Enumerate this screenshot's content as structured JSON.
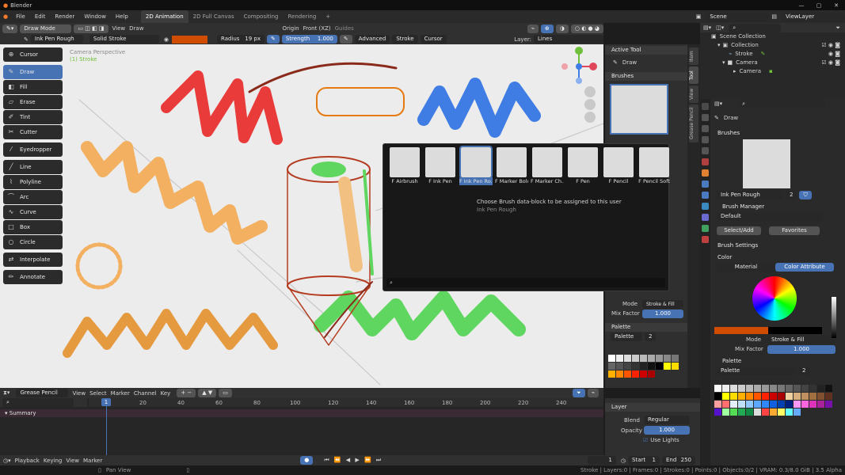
{
  "window": {
    "title": "Blender"
  },
  "menu": [
    "File",
    "Edit",
    "Render",
    "Window",
    "Help"
  ],
  "workspaces": [
    "2D Animation",
    "2D Full Canvas",
    "Compositing",
    "Rendering"
  ],
  "workspace_add": "+",
  "scene": "Scene",
  "view_layer": "ViewLayer",
  "header": {
    "mode": "Draw Mode",
    "view": "View",
    "draw": "Draw",
    "origin": "Origin",
    "front": "Front (XZ)",
    "guides": "Guides"
  },
  "tool_settings": {
    "brush": "Ink Pen Rough",
    "material": "Solid Stroke",
    "radius_label": "Radius",
    "radius": "19 px",
    "strength_label": "Strength",
    "strength": "1.000",
    "advanced": "Advanced",
    "stroke": "Stroke",
    "cursor": "Cursor",
    "layer_label": "Layer:",
    "layer": "Lines"
  },
  "tools": [
    {
      "label": "Cursor",
      "icon": "cursor-icon"
    },
    {
      "label": "Draw",
      "icon": "pencil-icon",
      "active": true
    },
    {
      "label": "Fill",
      "icon": "fill-icon"
    },
    {
      "label": "Erase",
      "icon": "eraser-icon"
    },
    {
      "label": "Tint",
      "icon": "tint-icon"
    },
    {
      "label": "Cutter",
      "icon": "cutter-icon"
    },
    {
      "label": "Eyedropper",
      "icon": "eyedropper-icon"
    },
    {
      "label": "Line",
      "icon": "line-icon"
    },
    {
      "label": "Polyline",
      "icon": "polyline-icon"
    },
    {
      "label": "Arc",
      "icon": "arc-icon"
    },
    {
      "label": "Curve",
      "icon": "curve-icon"
    },
    {
      "label": "Box",
      "icon": "box-icon"
    },
    {
      "label": "Circle",
      "icon": "circle-icon"
    },
    {
      "label": "Interpolate",
      "icon": "interpolate-icon"
    },
    {
      "label": "Annotate",
      "icon": "annotate-icon"
    }
  ],
  "viewport": {
    "camera": "Camera Perspective",
    "object": "(1) Stroke"
  },
  "npanel": {
    "active_tool": "Active Tool",
    "tool_name": "Draw",
    "brushes": "Brushes",
    "mode_label": "Mode",
    "mode": "Stroke & Fill",
    "mix_label": "Mix Factor",
    "mix": "1.000",
    "palette_head": "Palette",
    "palette_name": "Palette",
    "palette_users": "2",
    "tabs": [
      "Item",
      "Tool",
      "View",
      "Grease Pencil"
    ]
  },
  "brush_popup": {
    "brushes": [
      "F Airbrush",
      "F Ink Pen",
      "F Ink Pen Ro...",
      "F Marker Bold",
      "F Marker Ch...",
      "F Pen",
      "F Pencil",
      "F Pencil Soft"
    ],
    "selected_index": 2,
    "tooltip": "Choose Brush data-block to be assigned to this user",
    "tooltip_sub": "Ink Pen Rough",
    "search_placeholder": ""
  },
  "outliner": {
    "root": "Scene Collection",
    "collection": "Collection",
    "stroke": "Stroke",
    "camera": "Camera",
    "camera_child": "Camera"
  },
  "properties": {
    "tool": "Draw",
    "brushes": "Brushes",
    "brush_name": "Ink Pen Rough",
    "brush_users": "2",
    "brush_manager": "Brush Manager",
    "default": "Default",
    "select_add": "Select/Add",
    "favorites": "Favorites",
    "brush_settings": "Brush Settings",
    "color": "Color",
    "material_tab": "Material",
    "color_attr_tab": "Color Attribute",
    "mode_label": "Mode",
    "mode": "Stroke & Fill",
    "mix_label": "Mix Factor",
    "mix": "1.000",
    "palette": "Palette",
    "palette_name": "Palette",
    "palette_users": "2"
  },
  "timeline": {
    "editor": "Grease Pencil",
    "menus": [
      "View",
      "Select",
      "Marker",
      "Channel",
      "Key"
    ],
    "summary": "Summary",
    "current_frame": "1",
    "frames": [
      "20",
      "40",
      "60",
      "80",
      "100",
      "120",
      "140",
      "160",
      "180",
      "200",
      "220",
      "240"
    ]
  },
  "layer_panel": {
    "head": "Layer",
    "blend_label": "Blend",
    "blend": "Regular",
    "opacity_label": "Opacity",
    "opacity": "1.000",
    "use_lights": "Use Lights"
  },
  "playback": {
    "playback": "Playback",
    "keying": "Keying",
    "view": "View",
    "marker": "Marker",
    "frame": "1",
    "start_label": "Start",
    "start": "1",
    "end_label": "End",
    "end": "250"
  },
  "statusbar": {
    "left": "Pan View",
    "right": "Stroke | Layers:0 | Frames:0 | Strokes:0 | Points:0 | Objects:0/2 | VRAM: 0.3/8.0 GiB | 3.5 Alpha"
  },
  "palette_colors": [
    "#ffffff",
    "#eeeeee",
    "#dddddd",
    "#cccccc",
    "#bbbbbb",
    "#aaaaaa",
    "#999999",
    "#888888",
    "#777777",
    "#666666",
    "#555555",
    "#444444",
    "#333333",
    "#222222",
    "#111111",
    "#000000",
    "#ffff00",
    "#ffdd00",
    "#ffb000",
    "#ff8800",
    "#ff5500",
    "#ff2200",
    "#cc0000",
    "#aa0000"
  ],
  "props_palette_colors": [
    "#ffffff",
    "#eeeeee",
    "#dddddd",
    "#cccccc",
    "#bbbbbb",
    "#aaaaaa",
    "#999999",
    "#888888",
    "#777777",
    "#666666",
    "#555555",
    "#444444",
    "#333333",
    "#222222",
    "#111111",
    "#000000",
    "#ffff00",
    "#ffdd00",
    "#ffb000",
    "#ff8800",
    "#ff5500",
    "#ff2200",
    "#cc0000",
    "#aa0000",
    "#f0d0a0",
    "#d8b080",
    "#c09060",
    "#a07040",
    "#805030",
    "#603020",
    "#ff9f9f",
    "#ff6f6f",
    "#e5f0ff",
    "#bfe0ff",
    "#90c8ff",
    "#5fa8ff",
    "#3088ff",
    "#1060e0",
    "#0040b0",
    "#002080",
    "#ff99ff",
    "#ff66dd",
    "#dd33bb",
    "#aa2299",
    "#7711aa",
    "#5511cc",
    "#a0ffa0",
    "#55dd55",
    "#22aa55",
    "#118844",
    "#dddddd",
    "#ff4444",
    "#ffaa33",
    "#ffff66",
    "#66ffff",
    "#66aaff"
  ],
  "accent": "#4772b3",
  "color_swatch": "#cf4c00"
}
